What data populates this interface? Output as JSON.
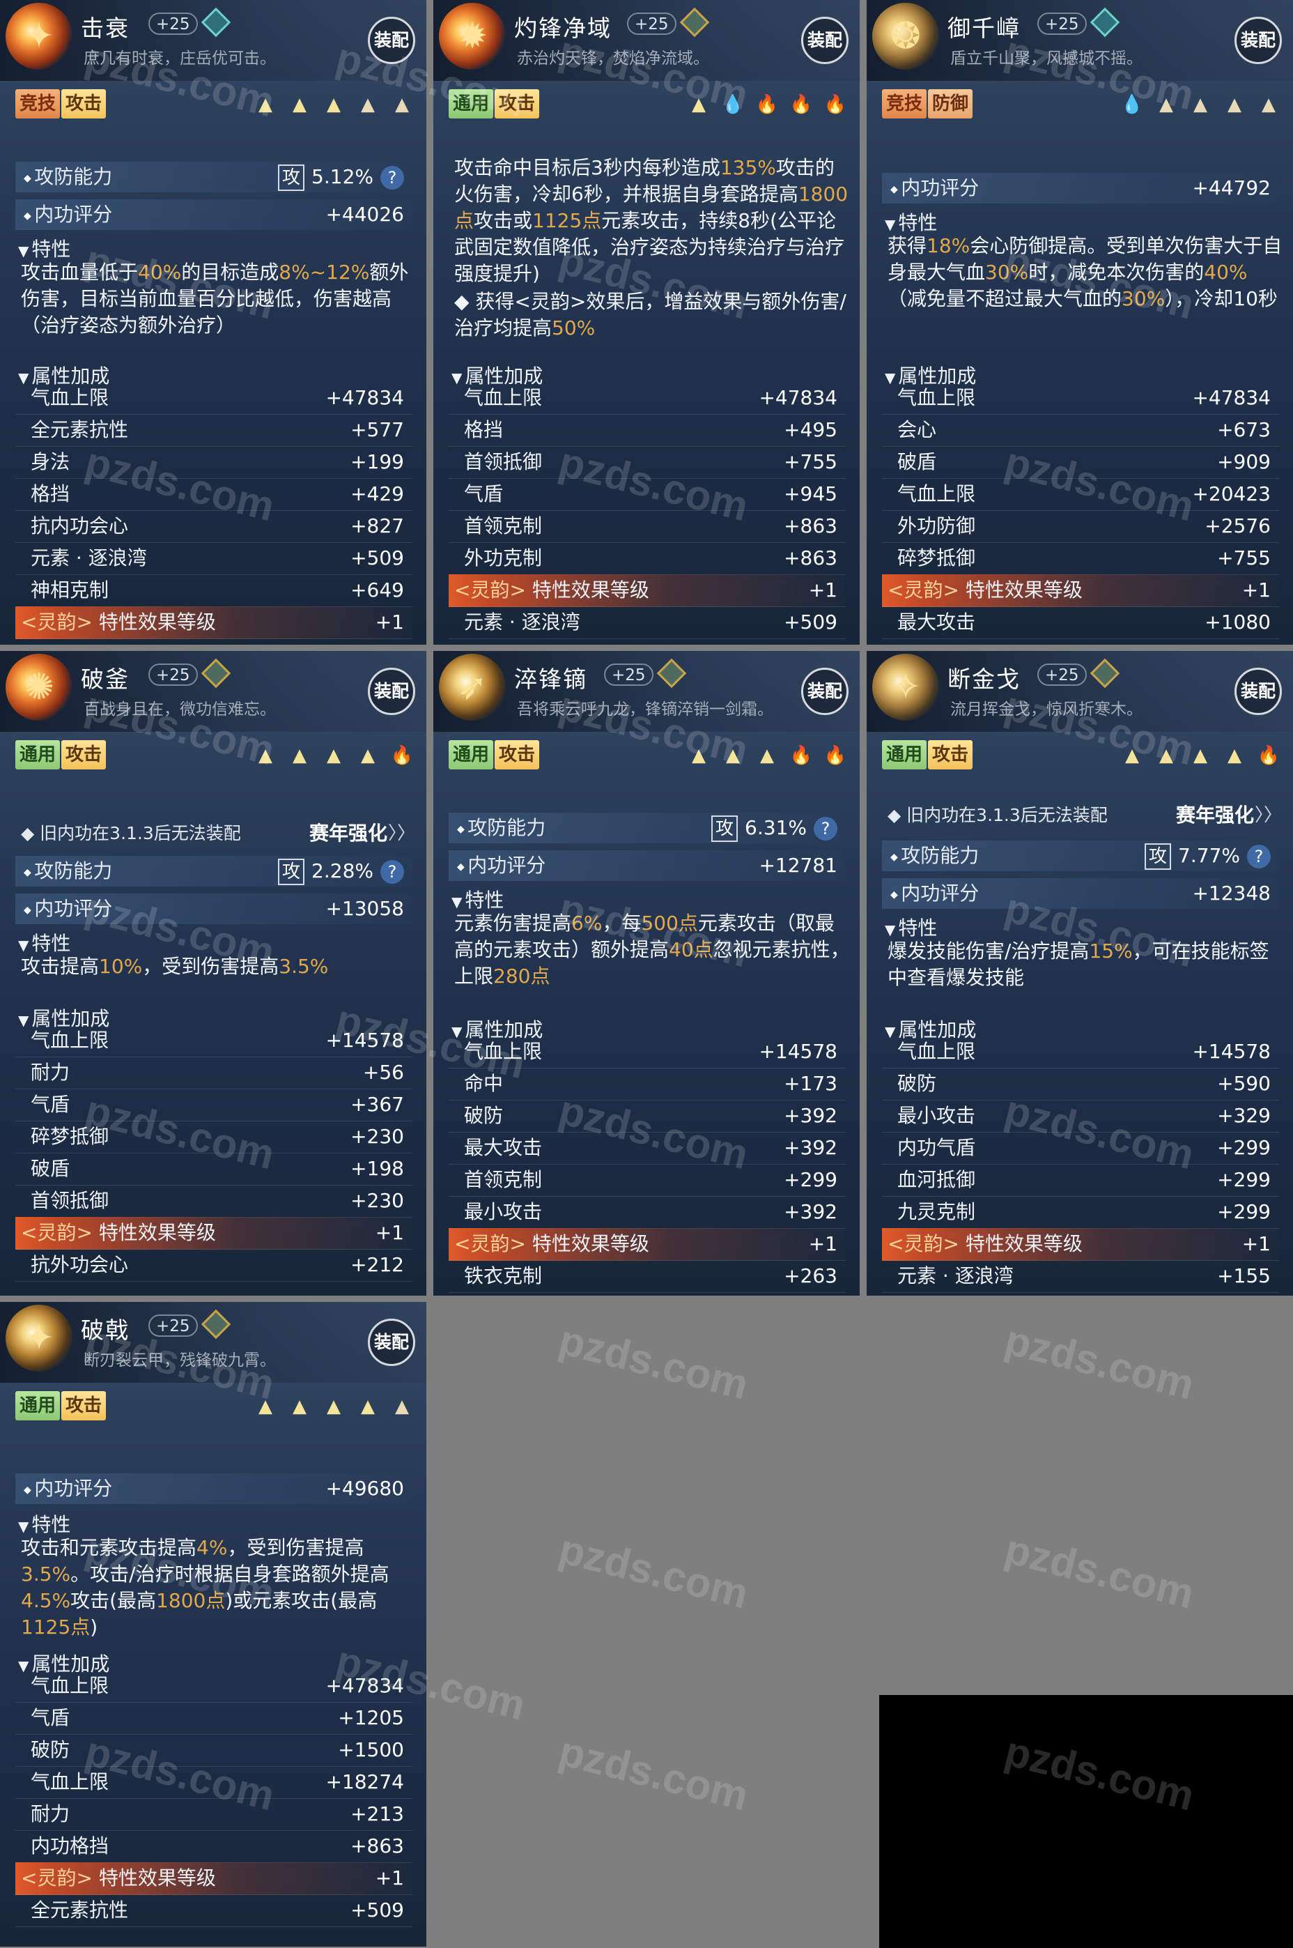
{
  "watermark": "pzds.com",
  "cards": [
    {
      "name": "击衰",
      "level": "+25",
      "motto": "庶几有时衰，庄岳优可击。",
      "equip": "装配",
      "tags": [
        "竞技",
        "攻击"
      ],
      "rating_label": "攻防能力",
      "rating_value": "5.12%",
      "atk_char": "攻",
      "score_label": "内功评分",
      "score": "+44026",
      "trait_label": "特性",
      "desc": "攻击血量低于40%的目标造成8%~12%额外伤害，目标当前血量百分比越低，伤害越高（治疗姿态为额外治疗）",
      "attr_label": "属性加成",
      "attrs": [
        [
          "气血上限",
          "+47834"
        ],
        [
          "全元素抗性",
          "+577"
        ],
        [
          "身法",
          "+199"
        ],
        [
          "格挡",
          "+429"
        ],
        [
          "抗内功会心",
          "+827"
        ],
        [
          "元素 · 逐浪湾",
          "+509"
        ],
        [
          "神相克制",
          "+649"
        ],
        [
          "<灵韵> 特性效果等级",
          "+1"
        ]
      ]
    },
    {
      "name": "灼锋净域",
      "level": "+25",
      "motto": "赤治灼天锋，焚焰净流域。",
      "equip": "装配",
      "tags": [
        "通用",
        "攻击"
      ],
      "trait_label": "特性",
      "desc": "攻击命中目标后3秒内每秒造成135%攻击的火伤害，冷却6秒，并根据自身套路提高1800点攻击或1125点元素攻击，持续8秒(公平论武固定数值降低，治疗姿态为持续治疗与治疗强度提升)",
      "desc2": "◆ 获得<灵韵>效果后，增益效果与额外伤害/治疗均提高50%",
      "attr_label": "属性加成",
      "attrs": [
        [
          "气血上限",
          "+47834"
        ],
        [
          "格挡",
          "+495"
        ],
        [
          "首领抵御",
          "+755"
        ],
        [
          "气盾",
          "+945"
        ],
        [
          "首领克制",
          "+863"
        ],
        [
          "外功克制",
          "+863"
        ],
        [
          "<灵韵> 特性效果等级",
          "+1"
        ],
        [
          "元素 · 逐浪湾",
          "+509"
        ]
      ]
    },
    {
      "name": "御千嶂",
      "level": "+25",
      "motto": "盾立千山聚，风撼城不摇。",
      "equip": "装配",
      "tags": [
        "竞技",
        "防御"
      ],
      "score_label": "内功评分",
      "score": "+44792",
      "trait_label": "特性",
      "desc": "获得18%会心防御提高。受到单次伤害大于自身最大气血30%时，减免本次伤害的40%（减免量不超过最大气血的30%），冷却10秒",
      "attr_label": "属性加成",
      "attrs": [
        [
          "气血上限",
          "+47834"
        ],
        [
          "会心",
          "+673"
        ],
        [
          "破盾",
          "+909"
        ],
        [
          "气血上限",
          "+20423"
        ],
        [
          "外功防御",
          "+2576"
        ],
        [
          "碎梦抵御",
          "+755"
        ],
        [
          "<灵韵> 特性效果等级",
          "+1"
        ],
        [
          "最大攻击",
          "+1080"
        ]
      ]
    },
    {
      "name": "破釜",
      "level": "+25",
      "motto": "百战身且在，微功信难忘。",
      "equip": "装配",
      "tags": [
        "通用",
        "攻击"
      ],
      "note": "◆ 旧内功在3.1.3后无法装配",
      "note2": "赛年强化",
      "rating_label": "攻防能力",
      "rating_value": "2.28%",
      "atk_char": "攻",
      "score_label": "内功评分",
      "score": "+13058",
      "trait_label": "特性",
      "desc": "攻击提高10%，受到伤害提高3.5%",
      "attr_label": "属性加成",
      "attrs": [
        [
          "气血上限",
          "+14578"
        ],
        [
          "耐力",
          "+56"
        ],
        [
          "气盾",
          "+367"
        ],
        [
          "碎梦抵御",
          "+230"
        ],
        [
          "破盾",
          "+198"
        ],
        [
          "首领抵御",
          "+230"
        ],
        [
          "<灵韵> 特性效果等级",
          "+1"
        ],
        [
          "抗外功会心",
          "+212"
        ]
      ]
    },
    {
      "name": "淬锋镝",
      "level": "+25",
      "motto": "吾将乘云呼九龙，锋镝淬销一剑霜。",
      "equip": "装配",
      "tags": [
        "通用",
        "攻击"
      ],
      "rating_label": "攻防能力",
      "rating_value": "6.31%",
      "atk_char": "攻",
      "score_label": "内功评分",
      "score": "+12781",
      "trait_label": "特性",
      "desc": "元素伤害提高6%，每500点元素攻击（取最高的元素攻击）额外提高40点忽视元素抗性，上限280点",
      "attr_label": "属性加成",
      "attrs": [
        [
          "气血上限",
          "+14578"
        ],
        [
          "命中",
          "+173"
        ],
        [
          "破防",
          "+392"
        ],
        [
          "最大攻击",
          "+392"
        ],
        [
          "首领克制",
          "+299"
        ],
        [
          "最小攻击",
          "+392"
        ],
        [
          "<灵韵> 特性效果等级",
          "+1"
        ],
        [
          "铁衣克制",
          "+263"
        ]
      ]
    },
    {
      "name": "断金戈",
      "level": "+25",
      "motto": "流月挥金戈，惊风折寒木。",
      "equip": "装配",
      "tags": [
        "通用",
        "攻击"
      ],
      "note": "◆ 旧内功在3.1.3后无法装配",
      "note2": "赛年强化",
      "rating_label": "攻防能力",
      "rating_value": "7.77%",
      "atk_char": "攻",
      "score_label": "内功评分",
      "score": "+12348",
      "trait_label": "特性",
      "desc": "爆发技能伤害/治疗提高15%，可在技能标签中查看爆发技能",
      "attr_label": "属性加成",
      "attrs": [
        [
          "气血上限",
          "+14578"
        ],
        [
          "破防",
          "+590"
        ],
        [
          "最小攻击",
          "+329"
        ],
        [
          "内功气盾",
          "+299"
        ],
        [
          "血河抵御",
          "+299"
        ],
        [
          "九灵克制",
          "+299"
        ],
        [
          "<灵韵> 特性效果等级",
          "+1"
        ],
        [
          "元素 · 逐浪湾",
          "+155"
        ]
      ]
    },
    {
      "name": "破戟",
      "level": "+25",
      "motto": "断刃裂云甲，残锋破九霄。",
      "equip": "装配",
      "tags": [
        "通用",
        "攻击"
      ],
      "score_label": "内功评分",
      "score": "+49680",
      "trait_label": "特性",
      "desc": "攻击和元素攻击提高4%，受到伤害提高3.5%。攻击/治疗时根据自身套路额外提高4.5%攻击(最高1800点)或元素攻击(最高1125点)",
      "attr_label": "属性加成",
      "attrs": [
        [
          "气血上限",
          "+47834"
        ],
        [
          "气盾",
          "+1205"
        ],
        [
          "破防",
          "+1500"
        ],
        [
          "气血上限",
          "+18274"
        ],
        [
          "耐力",
          "+213"
        ],
        [
          "内功格挡",
          "+863"
        ],
        [
          "<灵韵> 特性效果等级",
          "+1"
        ],
        [
          "全元素抗性",
          "+509"
        ]
      ]
    }
  ]
}
